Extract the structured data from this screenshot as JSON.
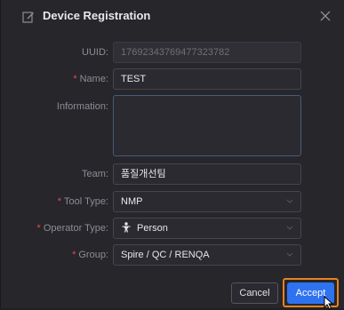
{
  "dialog": {
    "title": "Device Registration",
    "close_glyph": "×"
  },
  "form": {
    "uuid": {
      "label": "UUID:",
      "value": "17692343769477323782",
      "required": false
    },
    "name": {
      "label": "Name:",
      "value": "TEST",
      "required": true
    },
    "information": {
      "label": "Information:",
      "value": "",
      "required": false
    },
    "team": {
      "label": "Team:",
      "value": "품질개선팀",
      "required": false
    },
    "tool_type": {
      "label": "Tool Type:",
      "value": "NMP",
      "required": true
    },
    "operator_type": {
      "label": "Operator Type:",
      "value": "Person",
      "required": true,
      "icon": "person-icon"
    },
    "group": {
      "label": "Group:",
      "value": "Spire / QC / RENQA",
      "required": true
    }
  },
  "footer": {
    "cancel_label": "Cancel",
    "accept_label": "Accept"
  },
  "colors": {
    "background": "#26262b",
    "accent": "#2f72f0",
    "required": "#e54b4b",
    "highlight": "#e8821e"
  }
}
